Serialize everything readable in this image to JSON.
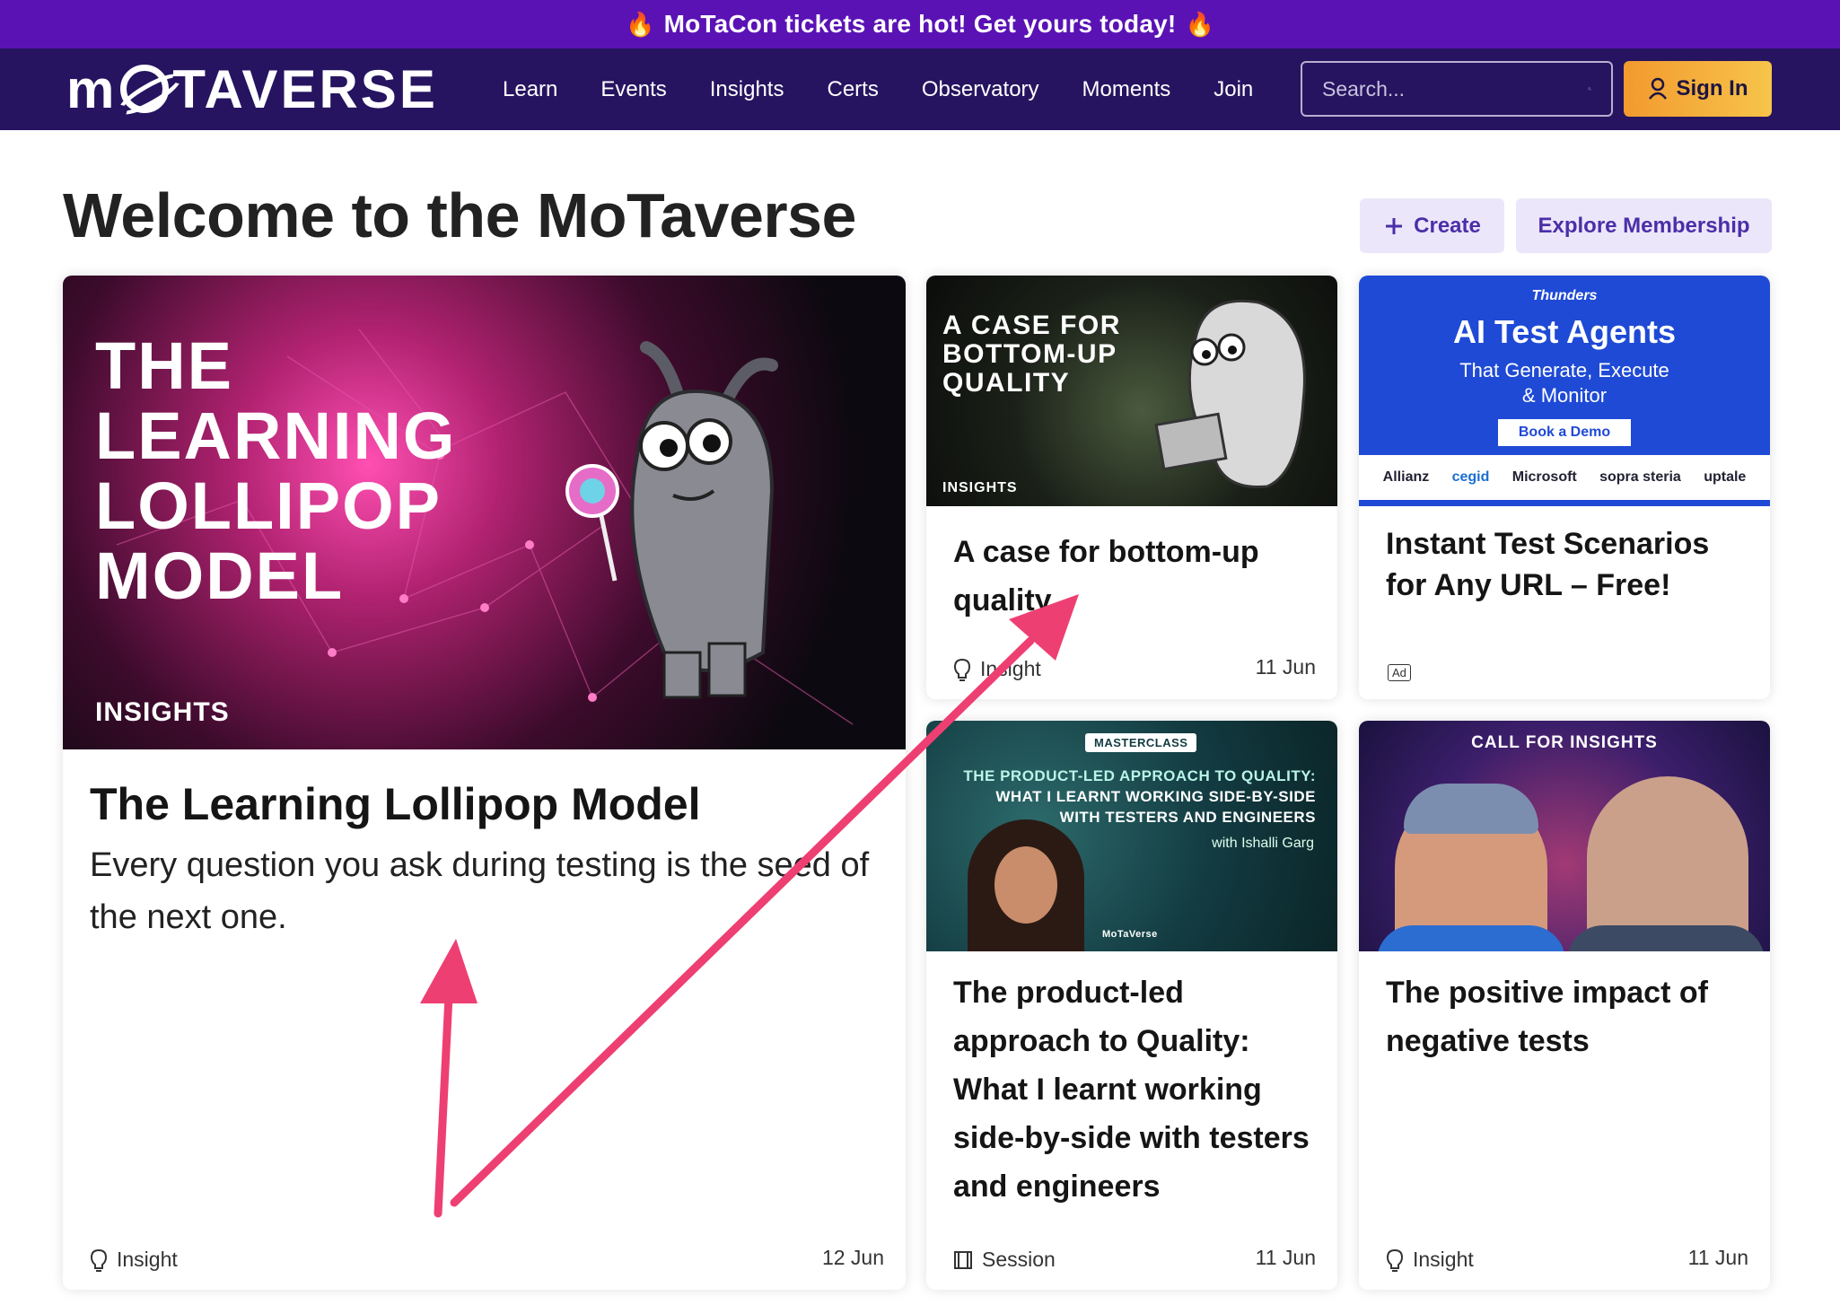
{
  "announcement": {
    "text": "MoTaCon tickets are hot! Get yours today!",
    "icon": "fire-icon"
  },
  "header": {
    "logo": "MoTaVerse",
    "nav": [
      "Learn",
      "Events",
      "Insights",
      "Certs",
      "Observatory",
      "Moments",
      "Join"
    ],
    "search_placeholder": "Search...",
    "sign_in_label": "Sign In"
  },
  "page": {
    "title": "Welcome to the MoTaverse",
    "create_label": "Create",
    "explore_label": "Explore Membership"
  },
  "cards": {
    "featured": {
      "image_title": "THE LEARNING LOLLIPOP MODEL",
      "image_tag": "INSIGHTS",
      "title": "The Learning Lollipop Model",
      "description": "Every question you ask during testing is the seed of the next one.",
      "type": "Insight",
      "date": "12 Jun"
    },
    "card1": {
      "image_title": "A CASE FOR BOTTOM-UP QUALITY",
      "image_tag": "INSIGHTS",
      "title": "A case for bottom-up quality",
      "type": "Insight",
      "date": "11 Jun"
    },
    "card2": {
      "brand": "Thunders",
      "ad_title": "AI Test Agents",
      "ad_sub": "That Generate, Execute & Monitor",
      "ad_button": "Book a Demo",
      "ad_logos": [
        "Allianz",
        "cegid",
        "Microsoft",
        "sopra steria",
        "uptale"
      ],
      "title": "Instant Test Scenarios for Any URL – Free!",
      "badge": "Ad"
    },
    "card3": {
      "image_badge": "MASTERCLASS",
      "image_title_line1": "THE PRODUCT-LED APPROACH TO QUALITY:",
      "image_title_line2": "WHAT I LEARNT WORKING SIDE-BY-SIDE",
      "image_title_line3": "WITH TESTERS AND ENGINEERS",
      "image_with": "with Ishalli Garg",
      "image_logo": "MoTaVerse",
      "title": "The product-led approach to Quality: What I learnt working side-by-side with testers and engineers",
      "type": "Session",
      "date": "11 Jun"
    },
    "card4": {
      "image_title": "CALL FOR INSIGHTS",
      "title": "The positive impact of negative tests",
      "type": "Insight",
      "date": "11 Jun"
    }
  },
  "colors": {
    "brand_purple": "#5a12b5",
    "nav_bg": "#261460",
    "accent_orange": "#f29a2e",
    "annotation_arrow": "#ee3f72"
  }
}
